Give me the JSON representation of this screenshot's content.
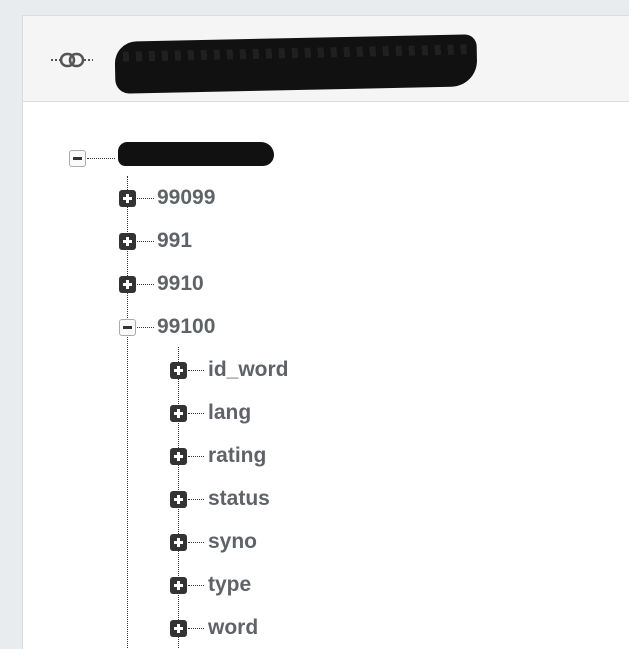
{
  "tree": {
    "root_children": [
      {
        "key": "99099",
        "expanded": false
      },
      {
        "key": "991",
        "expanded": false
      },
      {
        "key": "9910",
        "expanded": false
      },
      {
        "key": "99100",
        "expanded": true
      }
    ],
    "expanded_children": [
      "id_word",
      "lang",
      "rating",
      "status",
      "syno",
      "type",
      "word"
    ]
  },
  "icons": {
    "link": "link-icon",
    "expand": "plus-square-icon",
    "collapse": "minus-square-icon"
  },
  "colors": {
    "label": "#5f6368",
    "header_bg": "#f5f5f5",
    "page_bg": "#e9ecef"
  }
}
